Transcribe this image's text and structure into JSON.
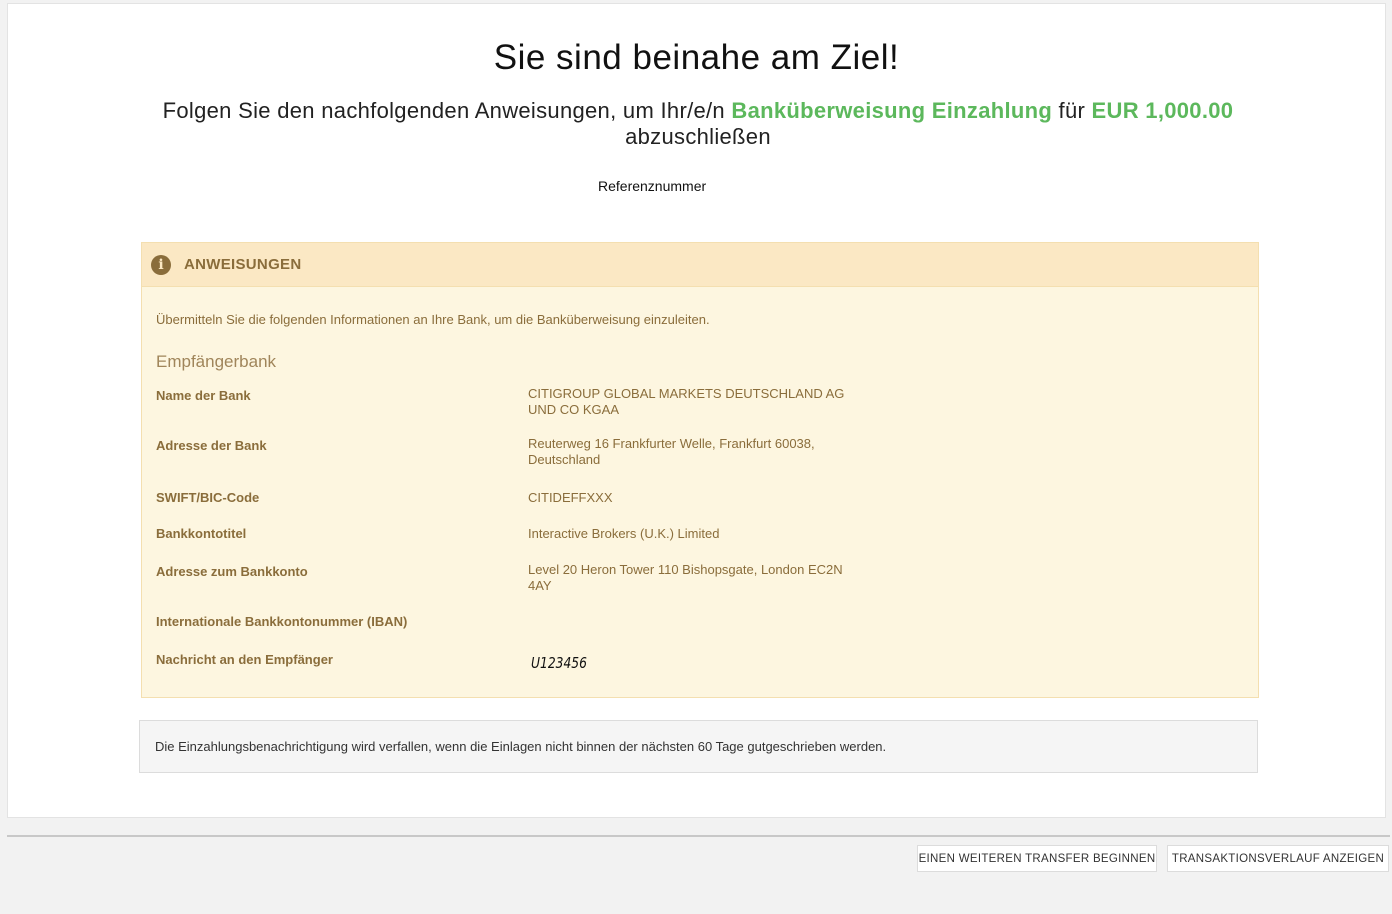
{
  "header": {
    "title": "Sie sind beinahe am Ziel!",
    "subtitle_pre": "Folgen Sie den nachfolgenden Anweisungen, um Ihr/e/n ",
    "subtitle_method": "Banküberweisung Einzahlung",
    "subtitle_mid": " für ",
    "subtitle_amount": "EUR 1,000.00",
    "subtitle_post": " abzuschließen",
    "reference_label": "Referenznummer"
  },
  "instructions": {
    "heading": "ANWEISUNGEN",
    "intro": "Übermitteln Sie die folgenden Informationen an Ihre Bank, um die Banküberweisung einzuleiten.",
    "section_title": "Empfängerbank",
    "rows": [
      {
        "label": "Name der Bank",
        "value": "CITIGROUP GLOBAL MARKETS DEUTSCHLAND AG UND CO KGAA"
      },
      {
        "label": "Adresse der Bank",
        "value": "Reuterweg 16 Frankfurter Welle, Frankfurt 60038, Deutschland"
      },
      {
        "label": "SWIFT/BIC-Code",
        "value": "CITIDEFFXXX"
      },
      {
        "label": "Bankkontotitel",
        "value": "Interactive Brokers (U.K.) Limited"
      },
      {
        "label": "Adresse zum Bankkonto",
        "value": "Level 20 Heron Tower 110 Bishopsgate, London EC2N 4AY"
      },
      {
        "label": "Internationale Bankkontonummer (IBAN)",
        "value": ""
      },
      {
        "label": "Nachricht an den Empfänger",
        "value": "U123456"
      }
    ]
  },
  "notice": "Die Einzahlungsbenachrichtigung wird verfallen, wenn die Einlagen nicht binnen der nächsten 60 Tage gutgeschrieben werden.",
  "footer": {
    "new_transfer_label": "EINEN WEITEREN TRANSFER BEGINNEN",
    "history_label": "TRANSAKTIONSVERLAUF ANZEIGEN"
  },
  "colors": {
    "accent_green": "#5cb85c",
    "warning_text": "#8a6d3b",
    "warning_bg": "#fdf6e0"
  }
}
